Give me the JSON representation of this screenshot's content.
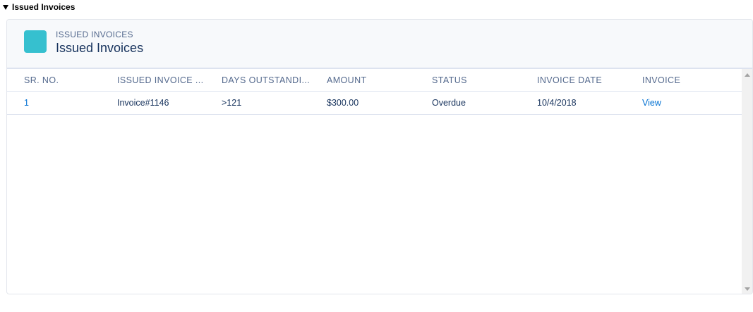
{
  "section": {
    "title": "Issued Invoices"
  },
  "card": {
    "icon": "invoice-card-icon",
    "eyebrow": "ISSUED INVOICES",
    "title": "Issued Invoices",
    "accent_color": "#36c0cf"
  },
  "table": {
    "columns": [
      "SR. NO.",
      "ISSUED INVOICE ...",
      "DAYS OUTSTANDI...",
      "AMOUNT",
      "STATUS",
      "INVOICE DATE",
      "INVOICE"
    ],
    "rows": [
      {
        "sr_no": "1",
        "invoice": "Invoice#1146",
        "days": ">121",
        "amount": "$300.00",
        "status": "Overdue",
        "date": "10/4/2018",
        "action": "View"
      }
    ]
  },
  "colors": {
    "link": "#0070d2",
    "text": "#16325c",
    "muted": "#54698d"
  }
}
